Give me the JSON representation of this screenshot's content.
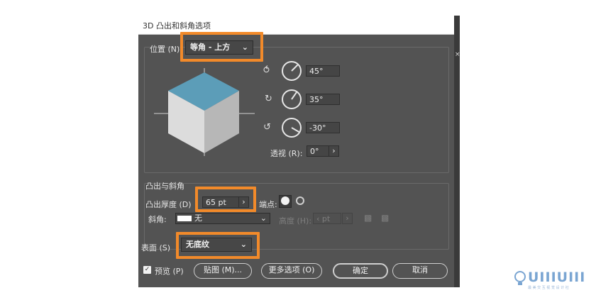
{
  "dialog": {
    "title": "3D 凸出和斜角选项"
  },
  "position": {
    "label": "位置 (N)",
    "value": "等角 - 上方",
    "x_rotation": "45°",
    "y_rotation": "35°",
    "z_rotation": "-30°",
    "perspective_label": "透视 (R):",
    "perspective_value": "0°"
  },
  "extrude": {
    "section_title": "凸出与斜角",
    "depth_label": "凸出厚度 (D)",
    "depth_value": "65 pt",
    "cap_label": "端点:",
    "bevel_label": "斜角:",
    "bevel_value": "无",
    "height_label": "高度 (H):",
    "height_value": "pt"
  },
  "surface": {
    "label": "表面 (S)",
    "value": "无底纹"
  },
  "footer": {
    "preview_label": "预览 (P)",
    "preview_checked": true,
    "map_button": "贴图 (M)...",
    "more_options_button": "更多选项 (O)",
    "ok_button": "确定",
    "cancel_button": "取消"
  },
  "logo": {
    "text": "UIIIUIII",
    "subtext": "最 美 交 互 视 觉 设 计 社"
  },
  "colors": {
    "dialog_bg": "#535353",
    "highlight": "#f28a2a",
    "cube_top": "#5c9db8",
    "cube_left": "#dcdcdc",
    "cube_right": "#b7b7b7"
  }
}
